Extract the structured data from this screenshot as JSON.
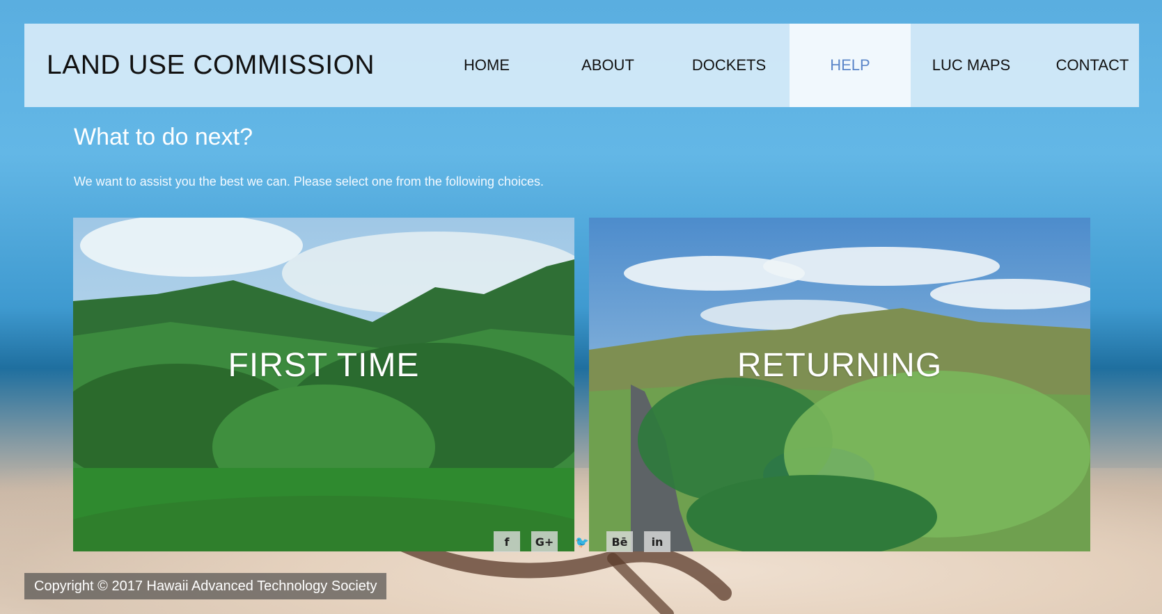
{
  "brand": "LAND USE COMMISSION",
  "nav": {
    "items": [
      {
        "label": "HOME",
        "active": false
      },
      {
        "label": "ABOUT",
        "active": false
      },
      {
        "label": "DOCKETS",
        "active": false
      },
      {
        "label": "HELP",
        "active": true
      },
      {
        "label": "LUC MAPS",
        "active": false
      },
      {
        "label": "CONTACT",
        "active": false
      }
    ]
  },
  "main": {
    "headline": "What to do next?",
    "subtext": "We want to assist you the best we can. Please select one from the following choices.",
    "tiles": [
      {
        "label": "FIRST TIME",
        "image": "tropical-forest-mountains"
      },
      {
        "label": "RETURNING",
        "image": "golf-course-aerial"
      }
    ]
  },
  "social": [
    {
      "icon": "facebook-icon",
      "glyph": "f"
    },
    {
      "icon": "google-plus-icon",
      "glyph": "G+"
    },
    {
      "icon": "twitter-icon",
      "glyph": "🐦"
    },
    {
      "icon": "behance-icon",
      "glyph": "Bē"
    },
    {
      "icon": "linkedin-icon",
      "glyph": "in"
    }
  ],
  "footer": {
    "copyright": "Copyright © 2017 Hawaii Advanced Technology Society"
  },
  "colors": {
    "nav_active_text": "#5b86c9",
    "nav_bg": "rgba(225,240,250,0.85)"
  }
}
